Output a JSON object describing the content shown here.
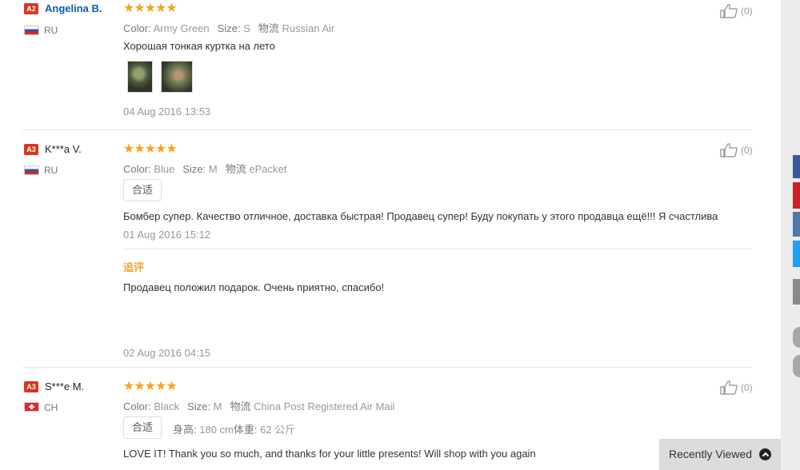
{
  "reviews": [
    {
      "level": "A2",
      "name": "Angelina B.",
      "country": "RU",
      "stars": "★★★★★",
      "color_label": "Color:",
      "color_value": "Army Green",
      "size_label": "Size:",
      "size_value": "S",
      "shipping_label": "物流",
      "shipping_value": "Russian Air",
      "text": "Хорошая тонкая куртка на лето",
      "date": "04 Aug 2016 13:53",
      "helpful": "(0)"
    },
    {
      "level": "A3",
      "name": "K***a V.",
      "country": "RU",
      "stars": "★★★★★",
      "color_label": "Color:",
      "color_value": "Blue",
      "size_label": "Size:",
      "size_value": "M",
      "shipping_label": "物流",
      "shipping_value": "ePacket",
      "tag": "合适",
      "text": "Бомбер супер. Качество отличное, доставка быстрая! Продавец супер! Буду покупать у этого продавца ещё!!! Я счастлива",
      "date": "01 Aug 2016 15:12",
      "append_title": "追评",
      "append_text": "Продавец положил подарок. Очень приятно, спасибо!",
      "append_date": "02 Aug 2016 04:15",
      "helpful": "(0)"
    },
    {
      "level": "A3",
      "name": "S***e M.",
      "country": "CH",
      "stars": "★★★★★",
      "color_label": "Color:",
      "color_value": "Black",
      "size_label": "Size:",
      "size_value": "M",
      "shipping_label": "物流",
      "shipping_value": "China Post Registered Air Mail",
      "tag": "合适",
      "height_label": "身高:",
      "height_value": "180 cm",
      "weight_label": "体重:",
      "weight_value": "62 公斤",
      "text": "LOVE IT! Thank you so much, and thanks for your little presents! Will shop with you again",
      "helpful": "(0)"
    }
  ],
  "recently_viewed": "Recently Viewed",
  "colors": {
    "star": "#f6a41b",
    "badge": "#d9361f",
    "link": "#0b5ea8",
    "append_title": "#f2a53a",
    "share": [
      "#3b5998",
      "#cb2027",
      "#4f78a8",
      "#1da1f2",
      "#8a8a8a"
    ]
  },
  "icons": {
    "thumb": "thumbs-up-icon",
    "chevron": "chevron-up-icon"
  }
}
